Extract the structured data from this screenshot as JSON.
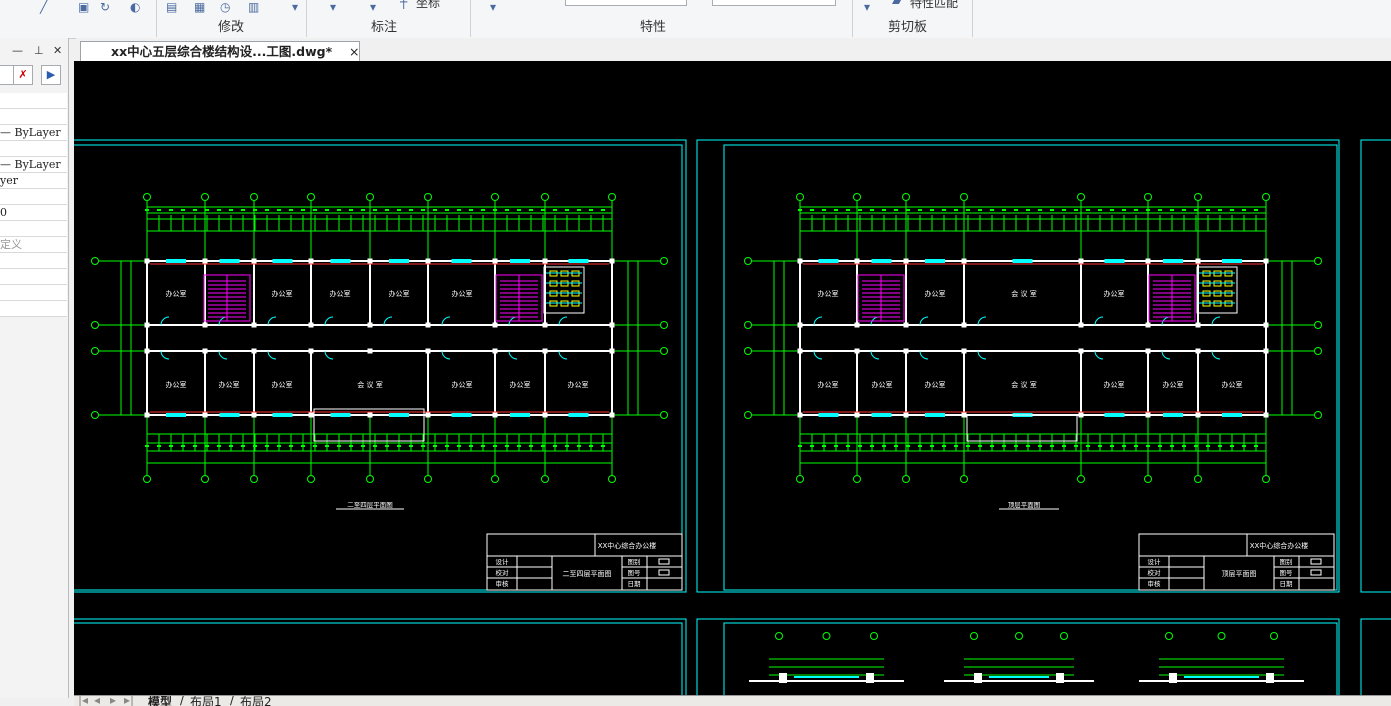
{
  "ribbon": {
    "groups": [
      "修改",
      "标注",
      "特性",
      "剪切板"
    ],
    "partial_labels": [
      "坐标",
      "特性匹配"
    ]
  },
  "palette": {
    "rows": [
      "",
      "",
      "— ByLayer",
      "",
      "— ByLayer",
      "yer",
      "",
      "0",
      "",
      "定义",
      "",
      "",
      "",
      ""
    ]
  },
  "document": {
    "tab_title": "xx中心五层综合楼结构设...工图.dwg*",
    "close": "×"
  },
  "drawings": {
    "sheet1": {
      "plan_title": "二至四层平面图",
      "project": "XX中心综合办公楼",
      "drawing_name": "二至四层平面图",
      "rooms_top": [
        "办公室",
        "办公室",
        "办公室",
        "办公室",
        "办公室"
      ],
      "rooms_bottom": [
        "办公室",
        "办公室",
        "办公室",
        "会 议 室",
        "办公室",
        "办公室",
        "办公室"
      ],
      "tb_left": [
        "设计",
        "校对",
        "审核"
      ],
      "tb_right": [
        "图别",
        "图号",
        "日期"
      ]
    },
    "sheet2": {
      "plan_title": "顶层平面图",
      "project": "XX中心综合办公楼",
      "drawing_name": "顶层平面图",
      "rooms_top": [
        "办公室",
        "办公室",
        "会 议 室",
        "办公室"
      ],
      "rooms_bottom": [
        "办公室",
        "办公室",
        "办公室",
        "会 议 室",
        "办公室",
        "办公室",
        "办公室"
      ],
      "tb_left": [
        "设计",
        "校对",
        "审核"
      ],
      "tb_right": [
        "图别",
        "图号",
        "日期"
      ]
    }
  },
  "layout_tabs": [
    "模型",
    "布局1",
    "布局2"
  ],
  "colors": {
    "canvas": "#000000",
    "frame": "#00ffff",
    "grid": "#00ff00",
    "wall": "#ffffff",
    "window": "#00ffff",
    "stair": "#ff00ff",
    "text": "#ffffff"
  }
}
